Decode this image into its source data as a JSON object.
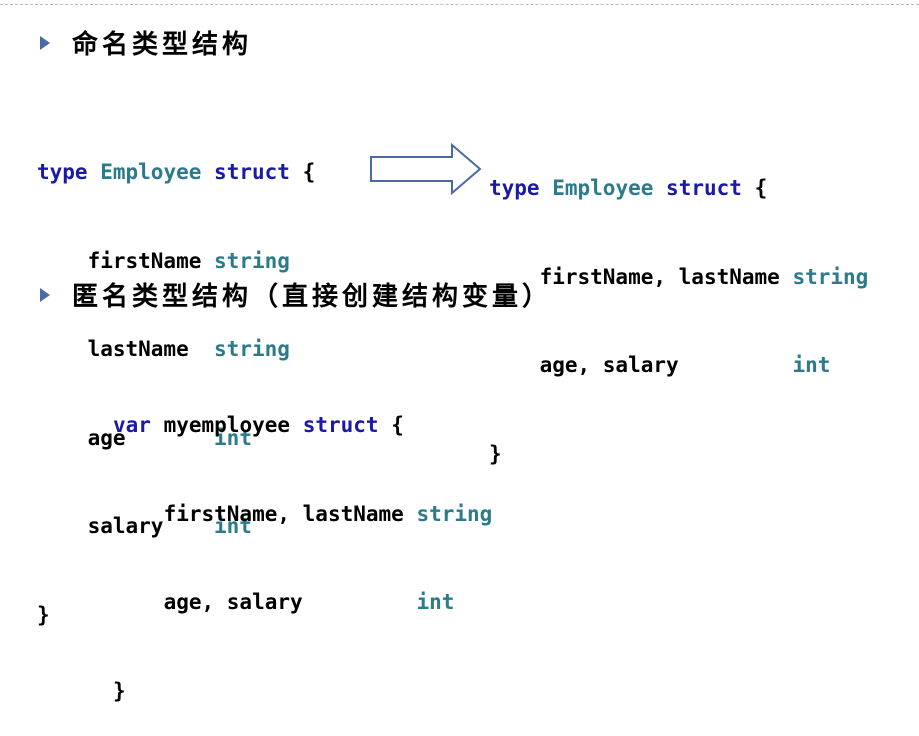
{
  "section1": {
    "title": "命名类型结构"
  },
  "section2": {
    "title": "匿名类型结构（直接创建结构变量）"
  },
  "code_named_long": {
    "kw_type": "type",
    "type_name": "Employee",
    "kw_struct": "struct",
    "open_brace": "{",
    "fields": [
      {
        "name": "firstName",
        "type": "string"
      },
      {
        "name": "lastName",
        "type": "string"
      },
      {
        "name": "age",
        "type": "int"
      },
      {
        "name": "salary",
        "type": "int"
      }
    ],
    "close_brace": "}"
  },
  "code_named_short": {
    "kw_type": "type",
    "type_name": "Employee",
    "kw_struct": "struct",
    "open_brace": "{",
    "fields": [
      {
        "names": "firstName, lastName",
        "type": "string"
      },
      {
        "names": "age, salary",
        "type": "int"
      }
    ],
    "close_brace": "}"
  },
  "code_anonymous": {
    "kw_var": "var",
    "var_name": "myemployee",
    "kw_struct": "struct",
    "open_brace": "{",
    "fields": [
      {
        "names": "firstName, lastName",
        "type": "string"
      },
      {
        "names": "age, salary",
        "type": "int"
      }
    ],
    "close_brace": "}"
  }
}
